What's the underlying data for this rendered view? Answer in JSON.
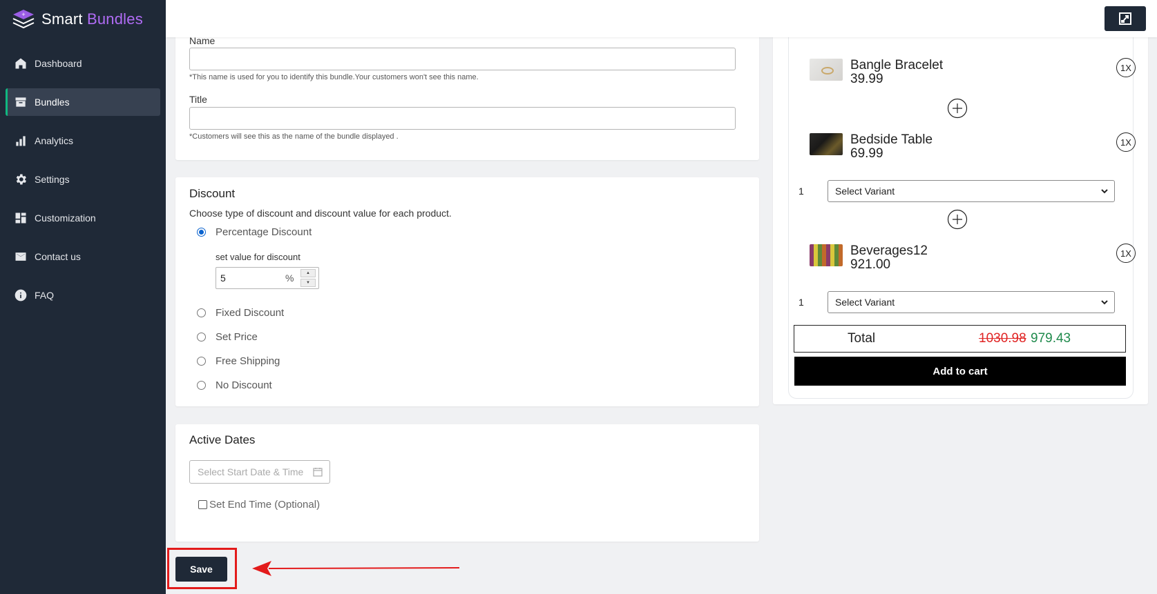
{
  "brand": {
    "name_part1": "Smart ",
    "name_part2": "Bundles",
    "accent_color": "#b06cf5"
  },
  "sidebar": {
    "items": [
      {
        "label": "Dashboard",
        "icon": "home-icon",
        "active": false
      },
      {
        "label": "Bundles",
        "icon": "box-icon",
        "active": true
      },
      {
        "label": "Analytics",
        "icon": "bar-chart-icon",
        "active": false
      },
      {
        "label": "Settings",
        "icon": "gear-icon",
        "active": false
      },
      {
        "label": "Customization",
        "icon": "layout-icon",
        "active": false
      },
      {
        "label": "Contact us",
        "icon": "mail-icon",
        "active": false
      },
      {
        "label": "FAQ",
        "icon": "info-icon",
        "active": false
      }
    ]
  },
  "topbar": {
    "expand_icon": "expand-icon"
  },
  "name_section": {
    "name_label": "Name",
    "name_value": "",
    "name_hint": "*This name is used for you to identify this bundle.Your customers won't see this name.",
    "title_label": "Title",
    "title_value": "",
    "title_hint": "*Customers will see this as the name of the bundle displayed ."
  },
  "discount": {
    "title": "Discount",
    "description": "Choose type of discount and discount value for each product.",
    "options": [
      {
        "label": "Percentage Discount",
        "selected": true
      },
      {
        "label": "Fixed Discount",
        "selected": false
      },
      {
        "label": "Set Price",
        "selected": false
      },
      {
        "label": "Free Shipping",
        "selected": false
      },
      {
        "label": "No Discount",
        "selected": false
      }
    ],
    "value_label": "set value for discount",
    "value": "5",
    "unit": "%"
  },
  "active_dates": {
    "title": "Active Dates",
    "start_placeholder": "Select Start Date & Time",
    "end_time_label": "Set End Time (Optional)",
    "end_time_checked": false
  },
  "preview": {
    "products": [
      {
        "name": "Bangle Bracelet",
        "price": "39.99",
        "qty_badge": "1X",
        "has_variant": false
      },
      {
        "name": "Bedside Table",
        "price": "69.99",
        "qty_badge": "1X",
        "has_variant": true,
        "variant_qty": "1",
        "variant_label": "Select Variant"
      },
      {
        "name": "Beverages12",
        "price": "921.00",
        "qty_badge": "1X",
        "has_variant": true,
        "variant_qty": "1",
        "variant_label": "Select Variant"
      }
    ],
    "total_label": "Total",
    "total_original": "1030.98",
    "total_discounted": "979.43",
    "add_to_cart": "Add to cart"
  },
  "save_label": "Save",
  "annotation_color": "#e31b1b"
}
